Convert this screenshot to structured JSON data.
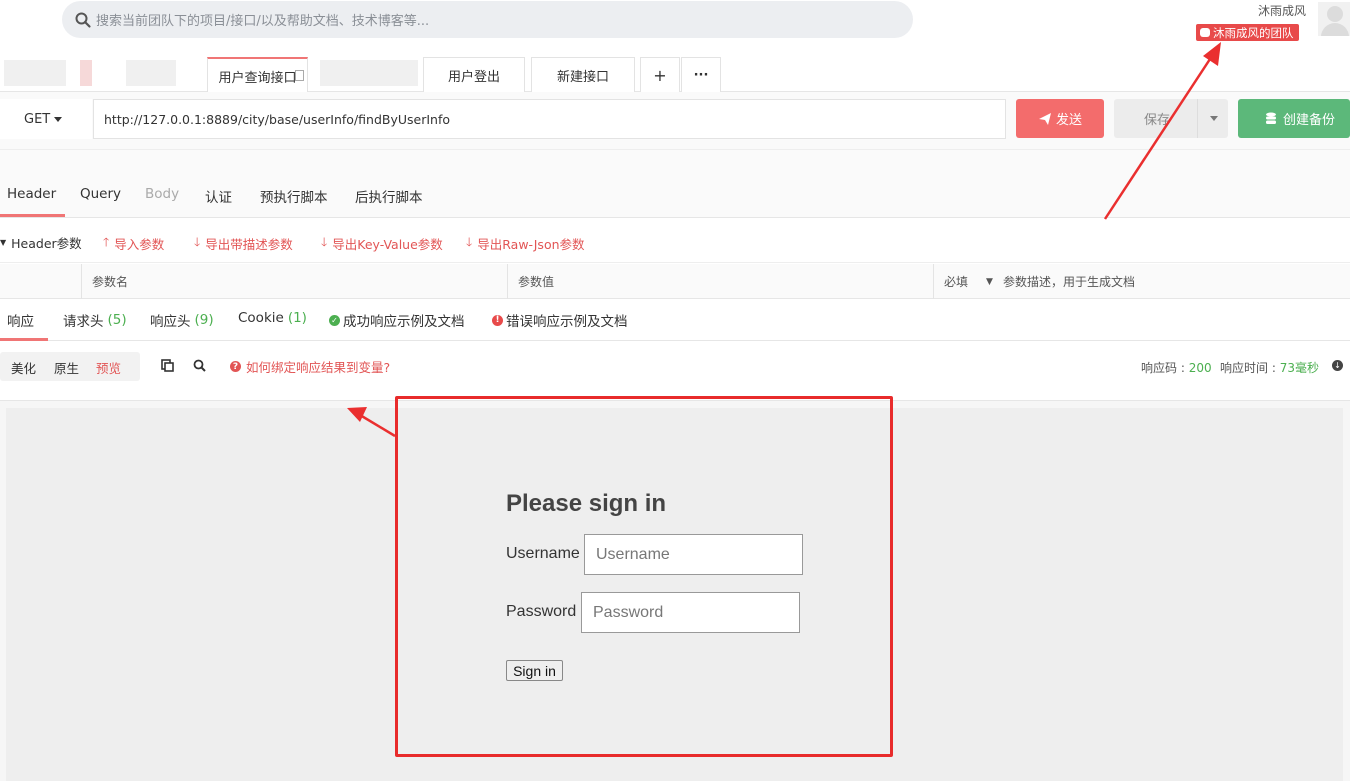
{
  "search": {
    "placeholder": "搜索当前团队下的项目/接口/以及帮助文档、技术博客等..."
  },
  "user": {
    "name": "沐雨成风",
    "team": "沐雨成风的团队"
  },
  "tabs": [
    {
      "label": "用户查询接口"
    },
    {
      "label": "用户登出"
    },
    {
      "label": "新建接口"
    },
    {
      "label": "+"
    },
    {
      "label": "···"
    }
  ],
  "request": {
    "method": "GET",
    "url": "http://127.0.0.1:8889/city/base/userInfo/findByUserInfo",
    "send_label": "发送",
    "save_label": "保存",
    "backup_label": "创建备份"
  },
  "req_tabs": [
    "Header",
    "Query",
    "Body",
    "认证",
    "预执行脚本",
    "后执行脚本"
  ],
  "header_params": {
    "title": "Header参数",
    "actions": [
      "导入参数",
      "导出带描述参数",
      "导出Key-Value参数",
      "导出Raw-Json参数"
    ]
  },
  "param_columns": {
    "name": "参数名",
    "value": "参数值",
    "required": "必填",
    "desc": "参数描述，用于生成文档"
  },
  "resp_tabs": {
    "response": "响应",
    "req_headers": "请求头",
    "req_headers_count": "(5)",
    "resp_headers": "响应头",
    "resp_headers_count": "(9)",
    "cookie": "Cookie",
    "cookie_count": "(1)",
    "success_doc": "成功响应示例及文档",
    "error_doc": "错误响应示例及文档"
  },
  "view": {
    "modes": [
      "美化",
      "原生",
      "预览"
    ],
    "active_mode": "预览",
    "help": "如何绑定响应结果到变量?",
    "status_label": "响应码 :",
    "status_code": "200",
    "time_label": "响应时间 :",
    "time_value": "73毫秒"
  },
  "login": {
    "title": "Please sign in",
    "username_label": "Username",
    "username_placeholder": "Username",
    "password_label": "Password",
    "password_placeholder": "Password",
    "button": "Sign in"
  },
  "colors": {
    "accent_red": "#f36c6c",
    "success_green": "#5cb87a",
    "annotation_red": "#e82b2b"
  }
}
